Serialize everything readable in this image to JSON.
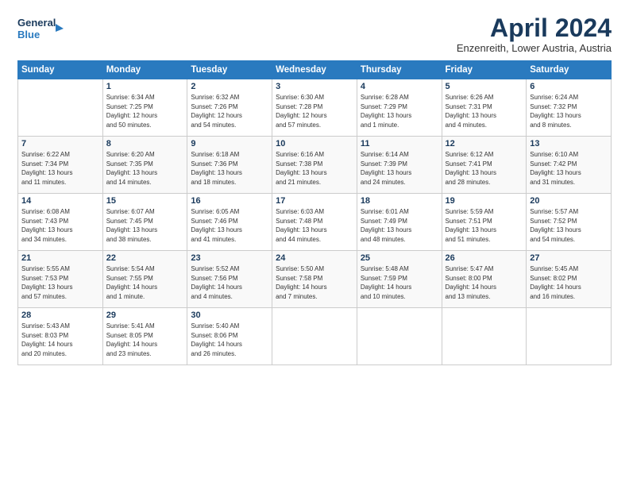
{
  "logo": {
    "line1": "General",
    "line2": "Blue"
  },
  "title": "April 2024",
  "location": "Enzenreith, Lower Austria, Austria",
  "headers": [
    "Sunday",
    "Monday",
    "Tuesday",
    "Wednesday",
    "Thursday",
    "Friday",
    "Saturday"
  ],
  "weeks": [
    [
      {
        "day": "",
        "lines": []
      },
      {
        "day": "1",
        "lines": [
          "Sunrise: 6:34 AM",
          "Sunset: 7:25 PM",
          "Daylight: 12 hours",
          "and 50 minutes."
        ]
      },
      {
        "day": "2",
        "lines": [
          "Sunrise: 6:32 AM",
          "Sunset: 7:26 PM",
          "Daylight: 12 hours",
          "and 54 minutes."
        ]
      },
      {
        "day": "3",
        "lines": [
          "Sunrise: 6:30 AM",
          "Sunset: 7:28 PM",
          "Daylight: 12 hours",
          "and 57 minutes."
        ]
      },
      {
        "day": "4",
        "lines": [
          "Sunrise: 6:28 AM",
          "Sunset: 7:29 PM",
          "Daylight: 13 hours",
          "and 1 minute."
        ]
      },
      {
        "day": "5",
        "lines": [
          "Sunrise: 6:26 AM",
          "Sunset: 7:31 PM",
          "Daylight: 13 hours",
          "and 4 minutes."
        ]
      },
      {
        "day": "6",
        "lines": [
          "Sunrise: 6:24 AM",
          "Sunset: 7:32 PM",
          "Daylight: 13 hours",
          "and 8 minutes."
        ]
      }
    ],
    [
      {
        "day": "7",
        "lines": [
          "Sunrise: 6:22 AM",
          "Sunset: 7:34 PM",
          "Daylight: 13 hours",
          "and 11 minutes."
        ]
      },
      {
        "day": "8",
        "lines": [
          "Sunrise: 6:20 AM",
          "Sunset: 7:35 PM",
          "Daylight: 13 hours",
          "and 14 minutes."
        ]
      },
      {
        "day": "9",
        "lines": [
          "Sunrise: 6:18 AM",
          "Sunset: 7:36 PM",
          "Daylight: 13 hours",
          "and 18 minutes."
        ]
      },
      {
        "day": "10",
        "lines": [
          "Sunrise: 6:16 AM",
          "Sunset: 7:38 PM",
          "Daylight: 13 hours",
          "and 21 minutes."
        ]
      },
      {
        "day": "11",
        "lines": [
          "Sunrise: 6:14 AM",
          "Sunset: 7:39 PM",
          "Daylight: 13 hours",
          "and 24 minutes."
        ]
      },
      {
        "day": "12",
        "lines": [
          "Sunrise: 6:12 AM",
          "Sunset: 7:41 PM",
          "Daylight: 13 hours",
          "and 28 minutes."
        ]
      },
      {
        "day": "13",
        "lines": [
          "Sunrise: 6:10 AM",
          "Sunset: 7:42 PM",
          "Daylight: 13 hours",
          "and 31 minutes."
        ]
      }
    ],
    [
      {
        "day": "14",
        "lines": [
          "Sunrise: 6:08 AM",
          "Sunset: 7:43 PM",
          "Daylight: 13 hours",
          "and 34 minutes."
        ]
      },
      {
        "day": "15",
        "lines": [
          "Sunrise: 6:07 AM",
          "Sunset: 7:45 PM",
          "Daylight: 13 hours",
          "and 38 minutes."
        ]
      },
      {
        "day": "16",
        "lines": [
          "Sunrise: 6:05 AM",
          "Sunset: 7:46 PM",
          "Daylight: 13 hours",
          "and 41 minutes."
        ]
      },
      {
        "day": "17",
        "lines": [
          "Sunrise: 6:03 AM",
          "Sunset: 7:48 PM",
          "Daylight: 13 hours",
          "and 44 minutes."
        ]
      },
      {
        "day": "18",
        "lines": [
          "Sunrise: 6:01 AM",
          "Sunset: 7:49 PM",
          "Daylight: 13 hours",
          "and 48 minutes."
        ]
      },
      {
        "day": "19",
        "lines": [
          "Sunrise: 5:59 AM",
          "Sunset: 7:51 PM",
          "Daylight: 13 hours",
          "and 51 minutes."
        ]
      },
      {
        "day": "20",
        "lines": [
          "Sunrise: 5:57 AM",
          "Sunset: 7:52 PM",
          "Daylight: 13 hours",
          "and 54 minutes."
        ]
      }
    ],
    [
      {
        "day": "21",
        "lines": [
          "Sunrise: 5:55 AM",
          "Sunset: 7:53 PM",
          "Daylight: 13 hours",
          "and 57 minutes."
        ]
      },
      {
        "day": "22",
        "lines": [
          "Sunrise: 5:54 AM",
          "Sunset: 7:55 PM",
          "Daylight: 14 hours",
          "and 1 minute."
        ]
      },
      {
        "day": "23",
        "lines": [
          "Sunrise: 5:52 AM",
          "Sunset: 7:56 PM",
          "Daylight: 14 hours",
          "and 4 minutes."
        ]
      },
      {
        "day": "24",
        "lines": [
          "Sunrise: 5:50 AM",
          "Sunset: 7:58 PM",
          "Daylight: 14 hours",
          "and 7 minutes."
        ]
      },
      {
        "day": "25",
        "lines": [
          "Sunrise: 5:48 AM",
          "Sunset: 7:59 PM",
          "Daylight: 14 hours",
          "and 10 minutes."
        ]
      },
      {
        "day": "26",
        "lines": [
          "Sunrise: 5:47 AM",
          "Sunset: 8:00 PM",
          "Daylight: 14 hours",
          "and 13 minutes."
        ]
      },
      {
        "day": "27",
        "lines": [
          "Sunrise: 5:45 AM",
          "Sunset: 8:02 PM",
          "Daylight: 14 hours",
          "and 16 minutes."
        ]
      }
    ],
    [
      {
        "day": "28",
        "lines": [
          "Sunrise: 5:43 AM",
          "Sunset: 8:03 PM",
          "Daylight: 14 hours",
          "and 20 minutes."
        ]
      },
      {
        "day": "29",
        "lines": [
          "Sunrise: 5:41 AM",
          "Sunset: 8:05 PM",
          "Daylight: 14 hours",
          "and 23 minutes."
        ]
      },
      {
        "day": "30",
        "lines": [
          "Sunrise: 5:40 AM",
          "Sunset: 8:06 PM",
          "Daylight: 14 hours",
          "and 26 minutes."
        ]
      },
      {
        "day": "",
        "lines": []
      },
      {
        "day": "",
        "lines": []
      },
      {
        "day": "",
        "lines": []
      },
      {
        "day": "",
        "lines": []
      }
    ]
  ]
}
